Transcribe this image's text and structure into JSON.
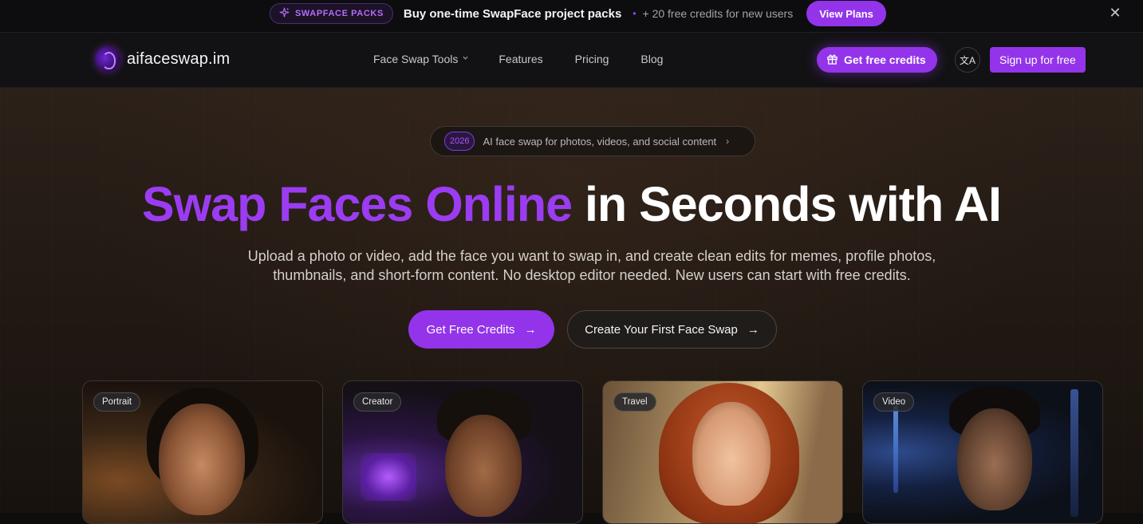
{
  "promo": {
    "badge": "SWAPFACE PACKS",
    "headline": "Buy one-time SwapFace project packs",
    "separator": "•",
    "sub": "+ 20 free credits for new users",
    "button": "View Plans",
    "close": "✕"
  },
  "nav": {
    "logo_text": "aifaceswap.im",
    "menu": [
      {
        "label": "Face Swap Tools"
      },
      {
        "label": "Features"
      },
      {
        "label": "Pricing"
      },
      {
        "label": "Blog"
      }
    ],
    "gift_button": "Get free credits",
    "lang_icon": "文A",
    "signup": "Sign up for free"
  },
  "hero": {
    "chip_year": "2026",
    "chip_text": "AI face swap for photos, videos, and social content",
    "chip_arrow": "›",
    "headline_accent": "Swap Faces Online",
    "headline_rest": " in Seconds with AI",
    "subcopy": "Upload a photo or video, add the face you want to swap in, and create clean edits for memes, profile photos, thumbnails, and short-form content. No desktop editor needed. New users can start with free credits.",
    "cta_primary": "Get Free Credits",
    "cta_secondary": "Create Your First Face Swap",
    "arrow": "→"
  },
  "cards": [
    {
      "tag": "Portrait"
    },
    {
      "tag": "Creator"
    },
    {
      "tag": "Travel"
    },
    {
      "tag": "Video"
    }
  ],
  "colors": {
    "accent": "#9334ea",
    "headline_accent": "#9b3cf2",
    "background": "#221a14"
  },
  "icons": {
    "promo_badge": "sparkles-icon",
    "close": "close-icon",
    "gift": "gift-icon",
    "translate": "translate-icon",
    "dropdown": "chevron-down-icon",
    "arrow": "arrow-right-icon"
  }
}
